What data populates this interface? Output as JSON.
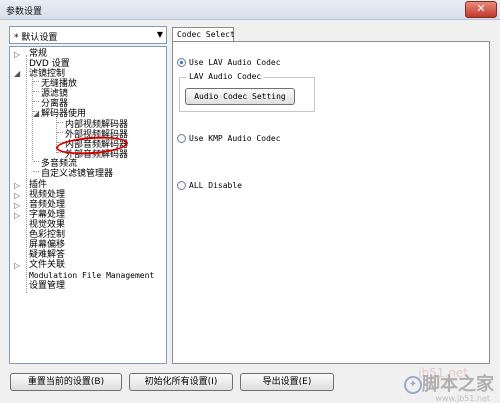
{
  "window": {
    "title": "参数设置",
    "close_glyph": "✕"
  },
  "preset": {
    "selected": "* 默认设置"
  },
  "tree": {
    "general": "常规",
    "dvd": "DVD 设置",
    "filter_control": "滤镜控制",
    "seamless": "无缝播放",
    "source_filter": "源滤镜",
    "splitter": "分离器",
    "decoder_use": "解码器使用",
    "internal_video": "内部视频解码器",
    "external_video": "外部视频解码器",
    "internal_audio": "内部音频解码器",
    "external_audio": "外部音频解码器",
    "multi_audio": "多音频流",
    "custom_filter": "自定义滤镜管理器",
    "plugins": "插件",
    "video_processing": "视频处理",
    "audio_processing": "音频处理",
    "subtitle_processing": "字幕处理",
    "visual_effects": "视觉效果",
    "color_control": "色彩控制",
    "screen_shift": "屏幕偏移",
    "troubleshoot": "疑难解答",
    "file_assoc": "文件关联",
    "modulation": "Modulation File Management",
    "settings_mgmt": "设置管理"
  },
  "tab": {
    "label": "Codec Select"
  },
  "codec": {
    "use_lav": "Use LAV Audio Codec",
    "group_label": "LAV Audio Codec",
    "setting_button": "Audio Codec Setting",
    "use_kmp": "Use KMP Audio Codec",
    "all_disable": "ALL Disable"
  },
  "footer": {
    "reset_current": "重置当前的设置(B)",
    "init_all": "初始化所有设置(I)",
    "export": "导出设置(E)"
  },
  "watermark": {
    "domain": "jb51.net",
    "brand": "脚本之家",
    "url": "www.jb51.net"
  }
}
